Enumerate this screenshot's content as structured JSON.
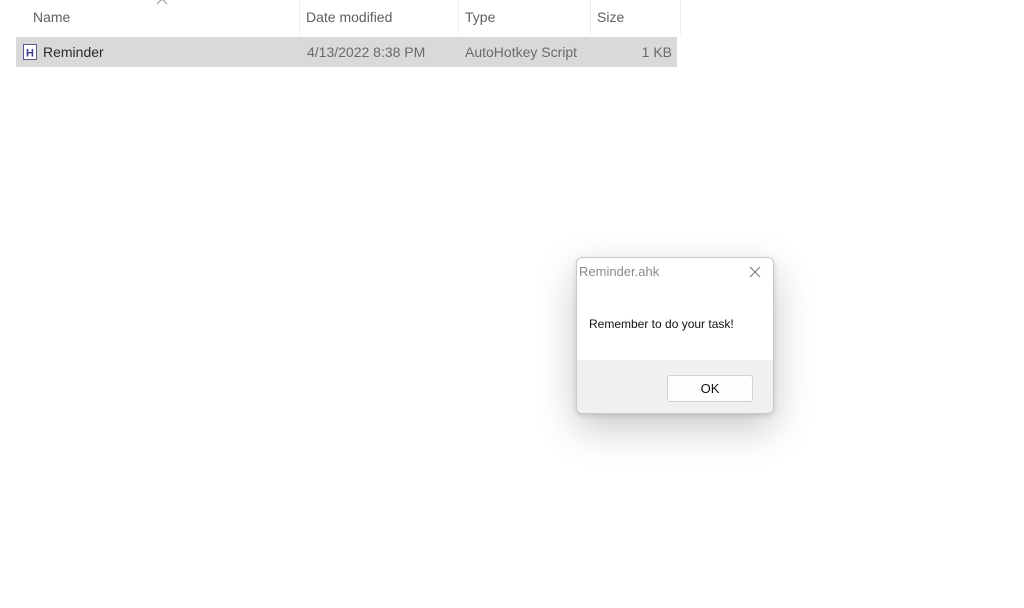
{
  "file_list": {
    "columns": [
      {
        "label": "Name"
      },
      {
        "label": "Date modified"
      },
      {
        "label": "Type"
      },
      {
        "label": "Size"
      }
    ],
    "sort_icon": "chevron-up-icon",
    "rows": [
      {
        "name": "Reminder",
        "date_modified": "4/13/2022 8:38 PM",
        "type": "AutoHotkey Script",
        "size": "1 KB",
        "icon": "ahk-file-icon",
        "selected": true
      }
    ],
    "colors": {
      "selected_row": "#d9d9d9",
      "header_text": "#5f5f5f"
    }
  },
  "dialog": {
    "title": "Reminder.ahk",
    "message": "Remember to do your task!",
    "ok_label": "OK",
    "close_icon": "close-icon",
    "colors": {
      "footer": "#f0f0f0",
      "title_text": "#8a8a8a"
    }
  }
}
